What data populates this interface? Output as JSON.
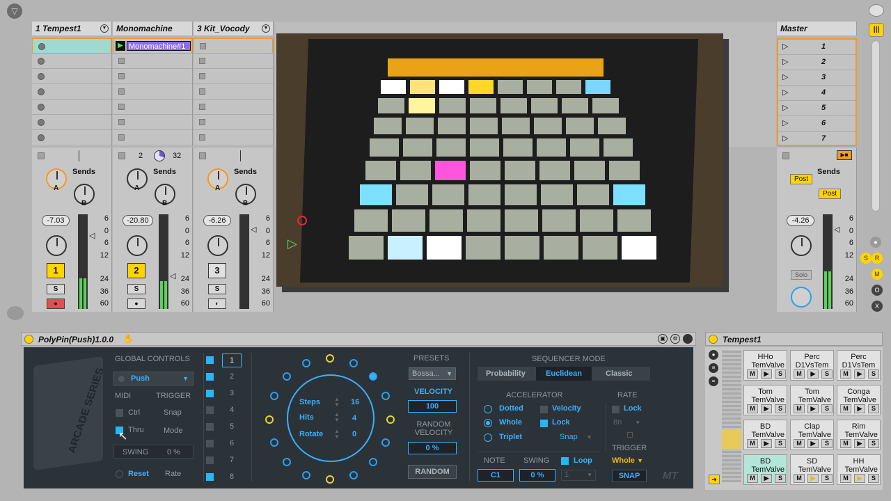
{
  "tracks": [
    {
      "name": "1 Tempest1",
      "volume": "-7.03",
      "number": "1",
      "solo": "S",
      "sends_label": "Sends"
    },
    {
      "name": "Monomachine",
      "volume": "-20.80",
      "number": "2",
      "solo": "S",
      "sends_label": "Sends",
      "clip": "Monomachine#1",
      "loop_start": "2",
      "loop_end": "32"
    },
    {
      "name": "3 Kit_Vocody",
      "volume": "-6.26",
      "number": "3",
      "solo": "S",
      "sends_label": "Sends"
    }
  ],
  "master": {
    "name": "Master",
    "scenes": [
      "1",
      "2",
      "3",
      "4",
      "5",
      "6",
      "7"
    ],
    "volume": "-4.26",
    "sends_label": "Sends",
    "post1": "Post",
    "post2": "Post",
    "solo": "Solo"
  },
  "send_knobs": {
    "a": "A",
    "b": "B"
  },
  "db_scale": [
    "6",
    "0",
    "6",
    "12",
    "24",
    "36",
    "60"
  ],
  "device": {
    "title": "PolyPin(Push)1.0.0",
    "global_controls": "GLOBAL CONTROLS",
    "push": "Push",
    "midi": "MIDI",
    "trigger": "TRIGGER",
    "ctrl": "Ctrl",
    "snap": "Snap",
    "thru": "Thru",
    "mode": "Mode",
    "swing_label": "SWING",
    "swing_val": "0 %",
    "reset": "Reset",
    "rate": "Rate",
    "tracks": [
      "1",
      "2",
      "3",
      "4",
      "5",
      "6",
      "7",
      "8"
    ],
    "steps_label": "Steps",
    "steps_val": "16",
    "hits_label": "Hits",
    "hits_val": "4",
    "rotate_label": "Rotate",
    "rotate_val": "0",
    "presets_label": "PRESETS",
    "preset_val": "Bossa...",
    "velocity_label": "VELOCITY",
    "velocity_val": "100",
    "random_velocity_label": "RANDOM VELOCITY",
    "random_velocity_val": "0 %",
    "random_btn": "RANDOM",
    "seq_mode_label": "SEQUENCER MODE",
    "seq_modes": [
      "Probability",
      "Euclidean",
      "Classic"
    ],
    "accelerator_label": "ACCELERATOR",
    "rate_label": "RATE",
    "dotted": "Dotted",
    "whole": "Whole",
    "triplet": "Triplet",
    "acc_velocity": "Velocity",
    "acc_lock": "Lock",
    "acc_snap": "Snap",
    "rate_lock": "Lock",
    "rate_val": "8n",
    "trigger_label": "TRIGGER",
    "trigger_val": "Whole",
    "snap_btn": "SNAP",
    "note_label": "NOTE",
    "note_val": "C1",
    "swing2_label": "SWING",
    "swing2_val": "0 %",
    "loop_label": "Loop",
    "loop_val": "1",
    "logo": "MT",
    "arcade": "ARCADE SERIES"
  },
  "drum_rack": {
    "title": "Tempest1",
    "pads": [
      [
        "HHo TemValve",
        "Perc D1VsTem",
        "Perc D1VsTem"
      ],
      [
        "Tom TemValve",
        "Tom TemValve",
        "Conga TemValve"
      ],
      [
        "BD TemValve",
        "Clap TemValve",
        "Rim TemValve"
      ],
      [
        "BD TemValve",
        "SD TemValve",
        "HH TemValve"
      ]
    ],
    "m": "M",
    "s": "S"
  },
  "colors": {
    "accent": "#3ab0ff",
    "yellow": "#ffd400",
    "orange": "#f39a1e"
  }
}
